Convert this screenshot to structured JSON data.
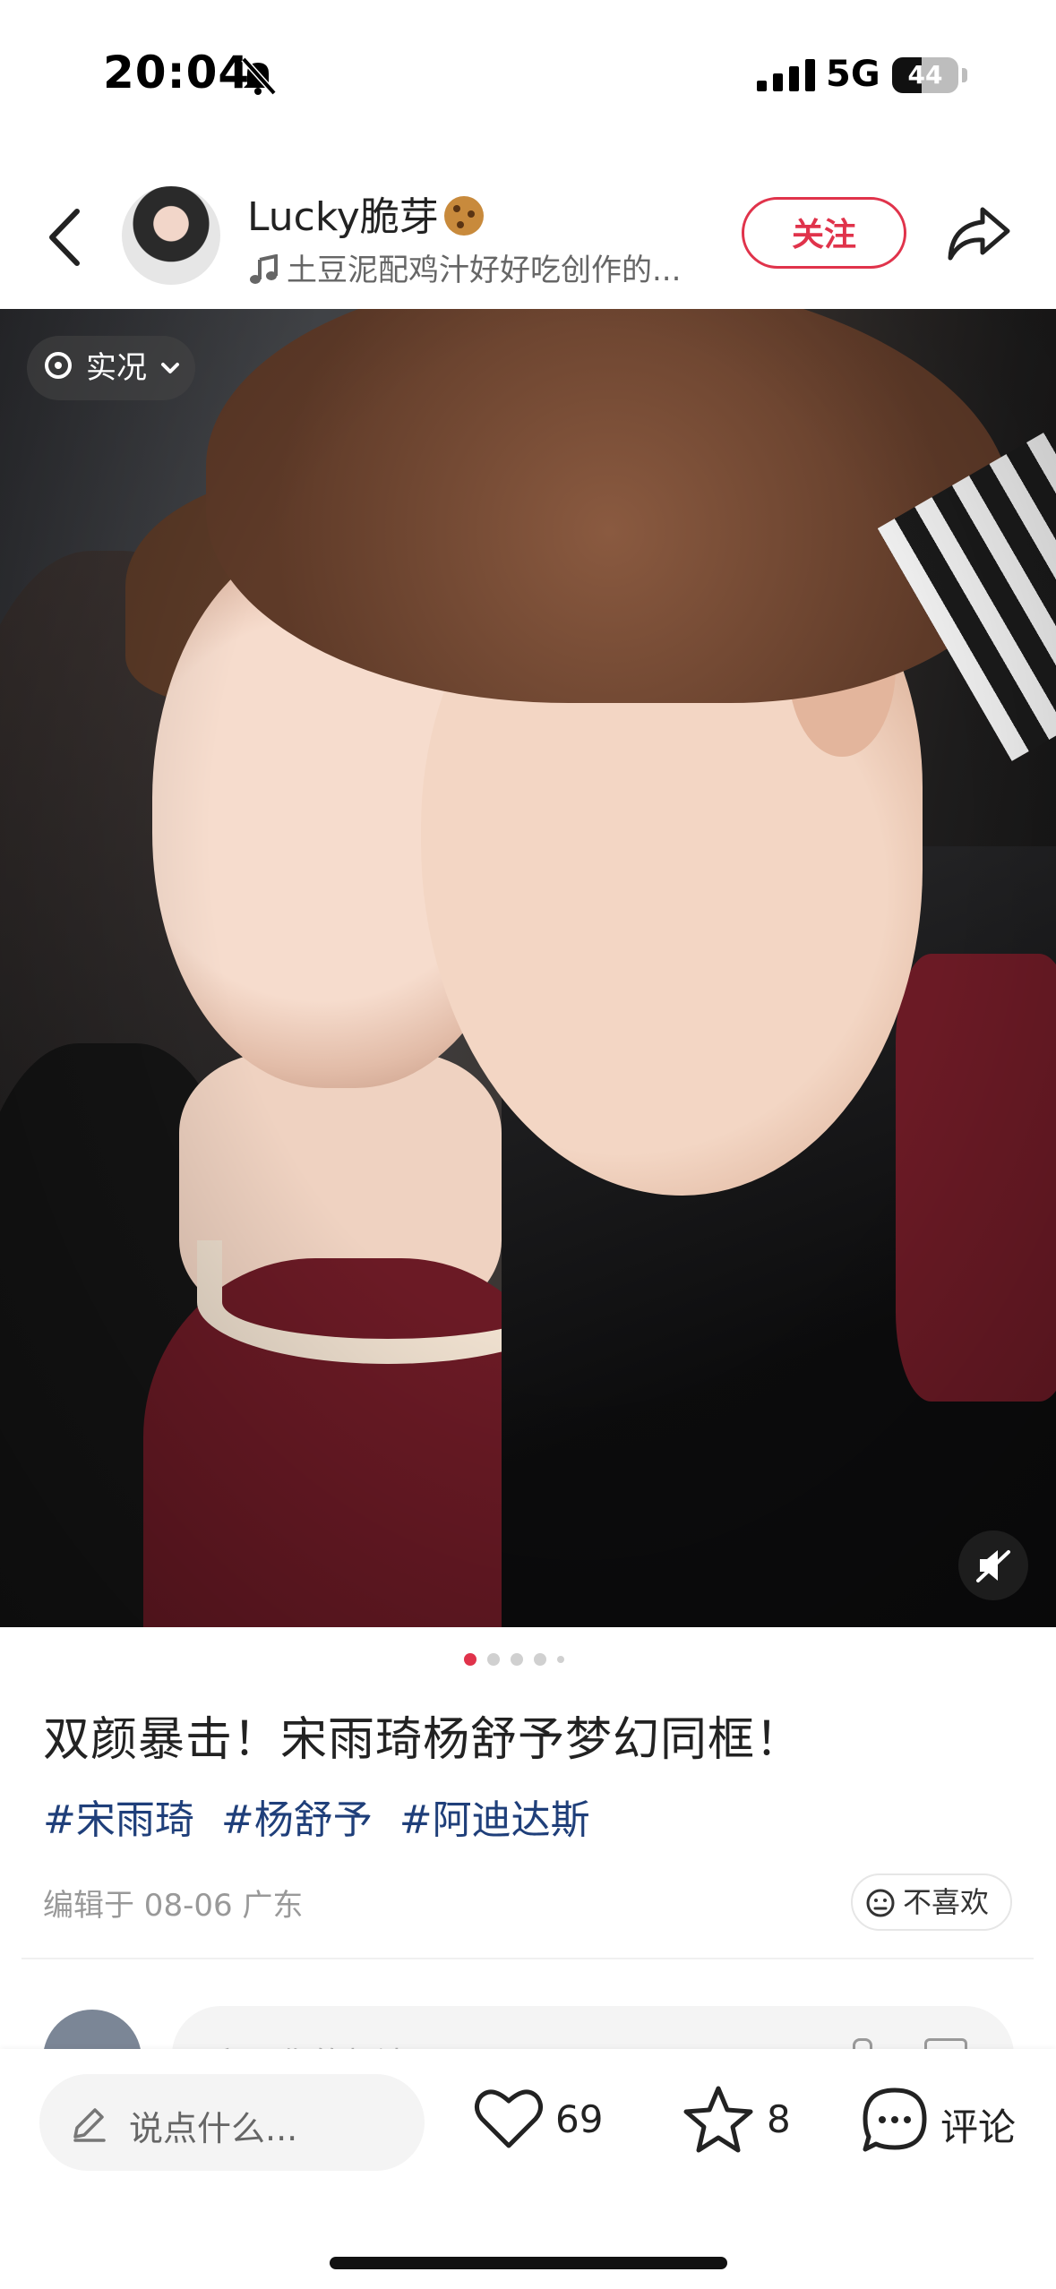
{
  "status_bar": {
    "time": "20:04",
    "network": "5G",
    "battery": "44",
    "battery_level_percent": 44,
    "icons": [
      "bell-off-icon",
      "signal-icon",
      "battery-icon"
    ]
  },
  "header": {
    "author_name": "Lucky脆芽",
    "author_emoji": "cookie-emoji",
    "music_text": "土豆泥配鸡汁好好吃创作的...",
    "follow_label": "关注",
    "icons": [
      "back-arrow-icon",
      "music-note-icon",
      "share-icon"
    ]
  },
  "media": {
    "live_label": "实况",
    "page_count": 5,
    "current_page": 1,
    "icons": [
      "live-photo-icon",
      "chevron-down-icon",
      "mute-icon"
    ]
  },
  "post": {
    "title": "双颜暴击！宋雨琦杨舒予梦幻同框！",
    "tags": [
      "#宋雨琦",
      "#杨舒予",
      "#阿迪达斯"
    ],
    "meta": "编辑于 08-06 广东",
    "dislike_label": "不喜欢"
  },
  "comment_box": {
    "placeholder": "留下你的想法吧"
  },
  "bottom_bar": {
    "say_placeholder": "说点什么...",
    "likes": "69",
    "stars": "8",
    "comment_label": "评论"
  },
  "colors": {
    "accent": "#e0334b",
    "tag": "#1f3f7a",
    "meta": "#999999"
  }
}
